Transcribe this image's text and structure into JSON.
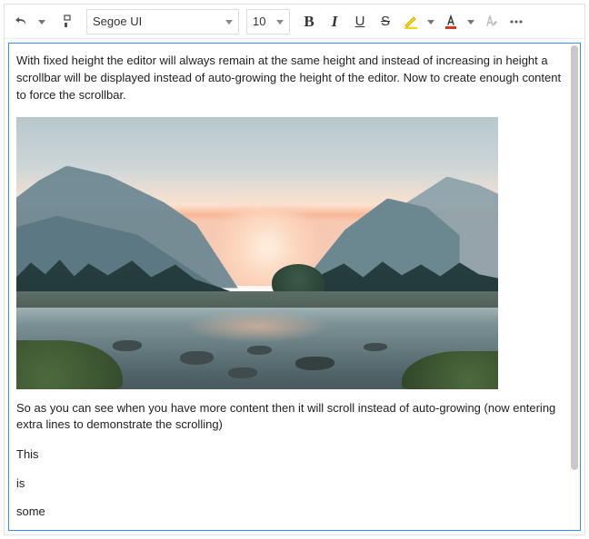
{
  "toolbar": {
    "font_family": "Segoe UI",
    "font_size": "10",
    "buttons": {
      "bold": "B",
      "italic": "I",
      "underline": "U",
      "strike": "S"
    },
    "highlight_color": "#ffd400",
    "font_fill_color": "#d13b1f",
    "font_color": "#000000"
  },
  "content": {
    "para1": "With fixed height the editor will always remain at the same height and instead of increasing in height a scrollbar will be displayed instead of auto-growing the height of the editor. Now to create enough content to force the scrollbar.",
    "para2": "So as you can see when you have more content then it will scroll instead of auto-growing (now entering extra lines to demonstrate the scrolling)",
    "lines": [
      "This",
      "is",
      "some"
    ]
  }
}
